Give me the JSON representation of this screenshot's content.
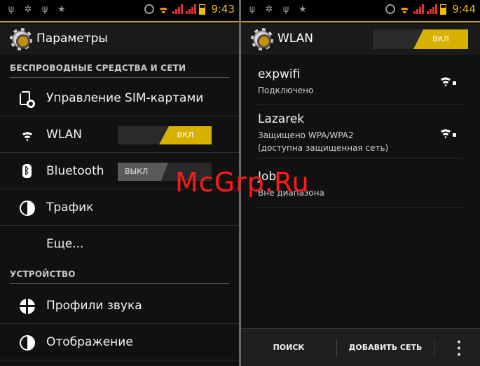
{
  "left": {
    "statusbar": {
      "time": "9:43"
    },
    "actionbar": {
      "title": "Параметры"
    },
    "sections": {
      "wireless": "БЕСПРОВОДНЫЕ СРЕДСТВА И СЕТИ",
      "device": "УСТРОЙСТВО"
    },
    "items": {
      "sim": "Управление SIM-картами",
      "wlan": "WLAN",
      "wlan_toggle": "ВКЛ",
      "bluetooth": "Bluetooth",
      "bluetooth_toggle": "ВЫКЛ",
      "traffic": "Трафик",
      "more": "Еще...",
      "sound": "Профили звука",
      "display": "Отображение"
    }
  },
  "right": {
    "statusbar": {
      "time": "9:44"
    },
    "actionbar": {
      "title": "WLAN",
      "toggle": "ВКЛ"
    },
    "networks": [
      {
        "ssid": "expwifi",
        "status": "Подключено"
      },
      {
        "ssid": "Lazarek",
        "status": "Защищено WPA/WPA2",
        "status2": "(доступна защищенная сеть)"
      },
      {
        "ssid": "Job",
        "status": "Вне диапазона"
      }
    ],
    "bottombar": {
      "search": "ПОИСК",
      "add": "ДОБАВИТЬ СЕТЬ"
    }
  },
  "watermark": "McGrp.Ru",
  "colors": {
    "accent": "#d8b000",
    "background": "#111111"
  }
}
